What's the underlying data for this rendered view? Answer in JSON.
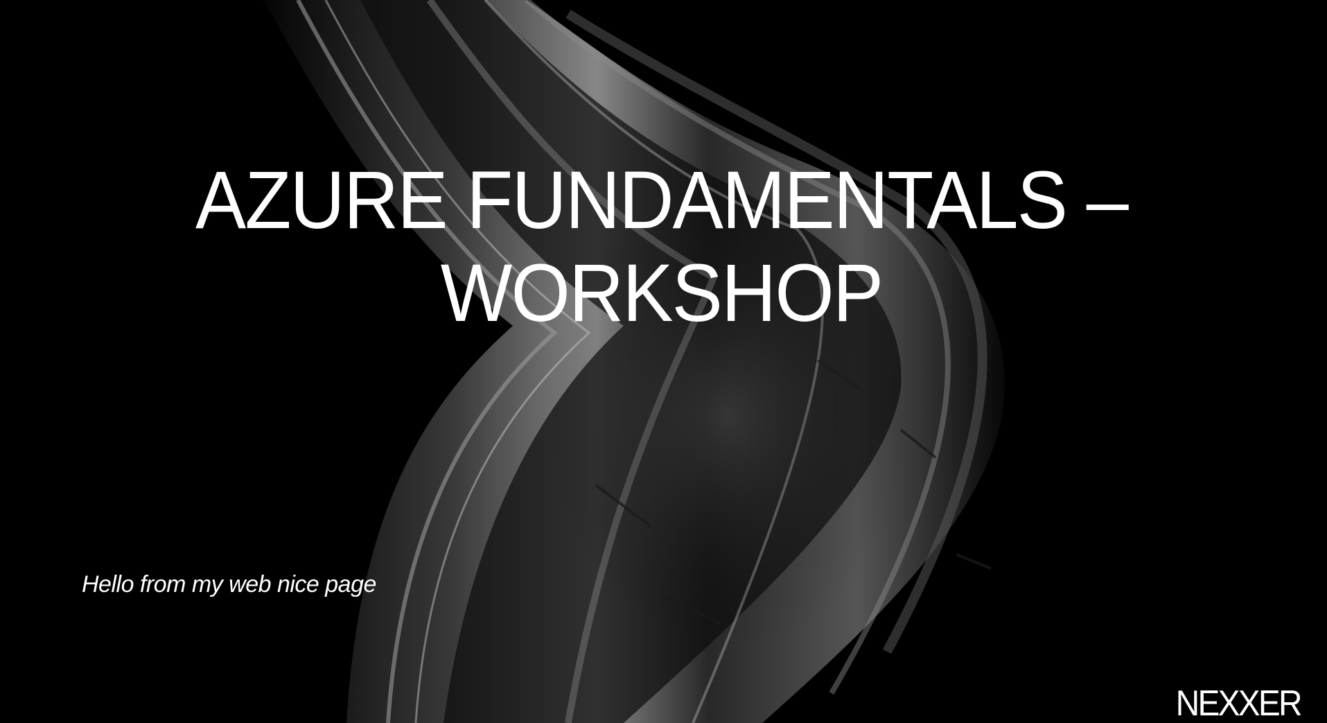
{
  "slide": {
    "title_line_1": "AZURE FUNDAMENTALS –",
    "title_line_2": "WORKSHOP",
    "subtitle": "Hello from my web nice page",
    "brand": "NEXXER"
  },
  "colors": {
    "background": "#000000",
    "text": "#ffffff",
    "artwork": "#6e6e6e"
  },
  "icons": {
    "background_artwork": "abstract-metallic-ribbon-image"
  }
}
